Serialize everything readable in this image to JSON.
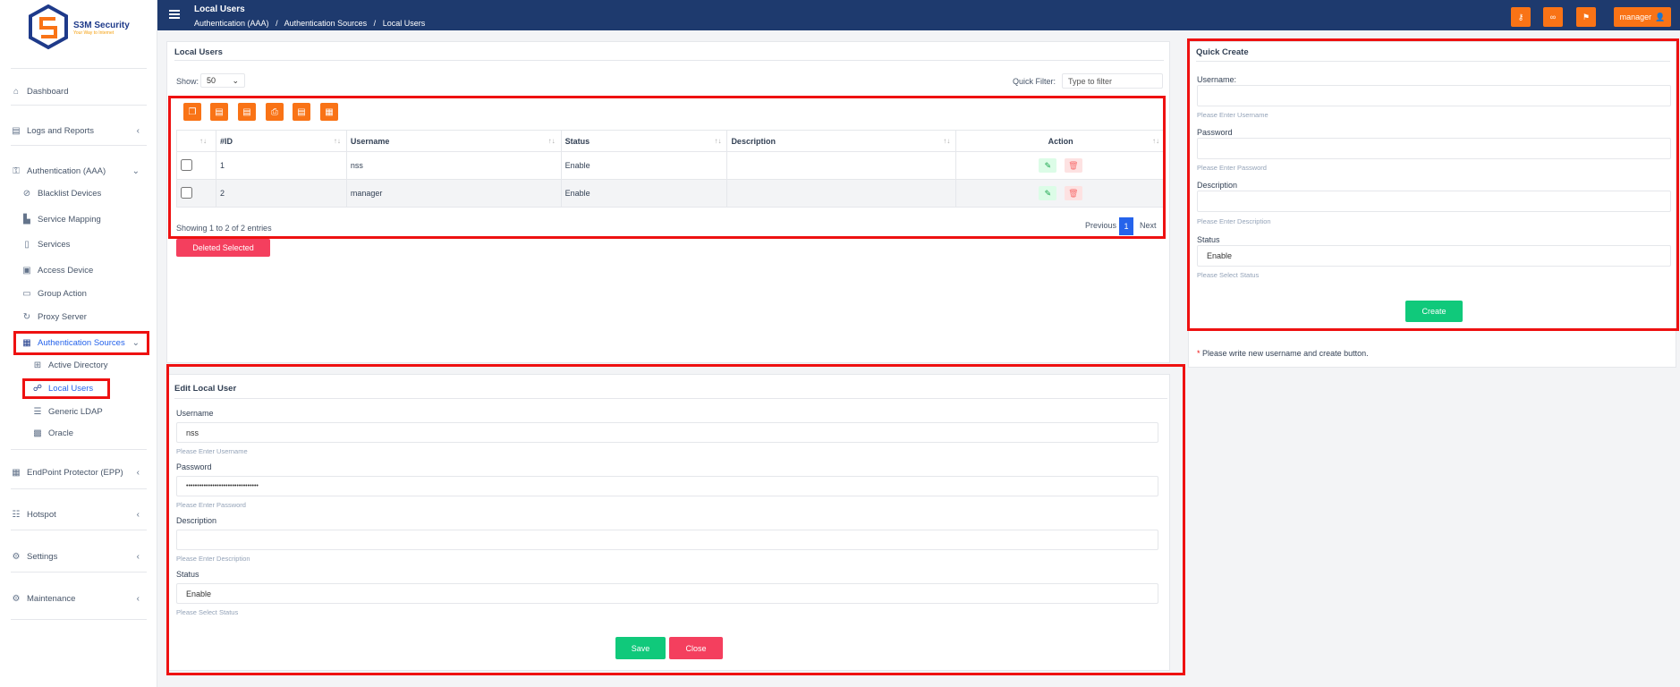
{
  "app": {
    "name": "S3M Security",
    "tagline": "Your Way to Internet"
  },
  "header": {
    "title": "Local Users",
    "breadcrumb": [
      "Authentication (AAA)",
      "Authentication Sources",
      "Local Users"
    ],
    "breadcrumb_sep": "/",
    "user_label": "manager"
  },
  "sidebar": {
    "dashboard": "Dashboard",
    "logs": "Logs and Reports",
    "aaa": "Authentication (AAA)",
    "blacklist": "Blacklist Devices",
    "service_mapping": "Service Mapping",
    "services": "Services",
    "access_device": "Access Device",
    "group_action": "Group Action",
    "proxy_server": "Proxy Server",
    "auth_sources": "Authentication Sources",
    "active_directory": "Active Directory",
    "local_users": "Local Users",
    "generic_ldap": "Generic LDAP",
    "oracle": "Oracle",
    "epp": "EndPoint Protector (EPP)",
    "hotspot": "Hotspot",
    "settings": "Settings",
    "maintenance": "Maintenance"
  },
  "list": {
    "title": "Local Users",
    "show_label": "Show:",
    "show_value": "50",
    "filter_label": "Quick Filter:",
    "filter_placeholder": "Type to filter",
    "columns": [
      "#ID",
      "Username",
      "Status",
      "Description",
      "Action"
    ],
    "rows": [
      {
        "id": "1",
        "username": "nss",
        "status": "Enable",
        "description": ""
      },
      {
        "id": "2",
        "username": "manager",
        "status": "Enable",
        "description": ""
      }
    ],
    "showing": "Showing 1 to 2 of 2 entries",
    "prev": "Previous",
    "page": "1",
    "next": "Next",
    "delete_selected": "Deleted Selected"
  },
  "edit": {
    "title": "Edit Local User",
    "username_label": "Username",
    "username_value": "nss",
    "username_hint": "Please Enter Username",
    "password_label": "Password",
    "password_value": "•••••••••••••••••••••••••••••••••",
    "password_hint": "Please Enter Password",
    "description_label": "Description",
    "description_value": "",
    "description_hint": "Please Enter Description",
    "status_label": "Status",
    "status_value": "Enable",
    "status_hint": "Please Select Status",
    "save": "Save",
    "close": "Close"
  },
  "quick": {
    "title": "Quick Create",
    "username_label": "Username:",
    "username_hint": "Please Enter Username",
    "password_label": "Password",
    "password_hint": "Please Enter Password",
    "description_label": "Description",
    "description_hint": "Please Enter Description",
    "status_label": "Status",
    "status_value": "Enable",
    "status_hint": "Please Select Status",
    "create": "Create",
    "note_star": "*",
    "note": "Please write new username and create button."
  },
  "colors": {
    "header": "#1e3a6e",
    "accent": "#f97316",
    "green": "#10c97b",
    "red": "#f43f5e",
    "highlight": "#ee1111"
  }
}
